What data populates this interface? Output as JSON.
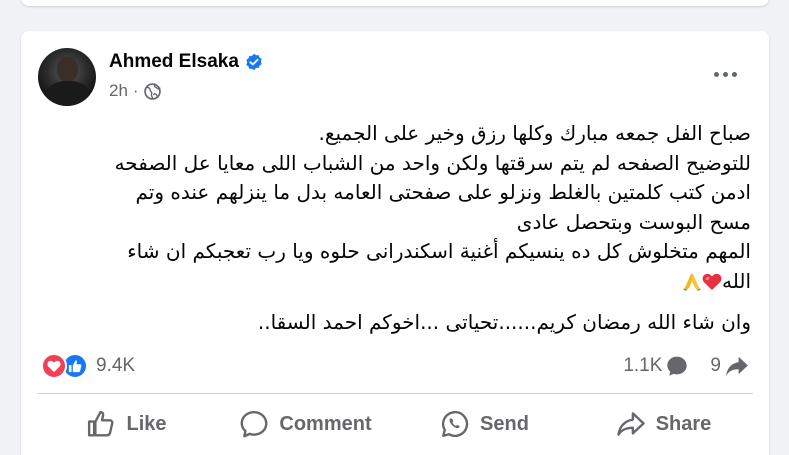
{
  "post": {
    "author": "Ahmed Elsaka",
    "time": "2h",
    "lines": [
      "صباح الفل جمعه مبارك وكلها رزق وخير على الجميع.",
      "للتوضيح الصفحه لم يتم سرقتها ولكن واحد من الشباب اللى معايا عل الصفحه",
      "ادمن كتب كلمتين بالغلط ونزلو على صفحتى العامه بدل ما ينزلهم عنده وتم",
      "مسح البوست وبتحصل عادى",
      "المهم متخلوش كل ده  ينسيكم أغنية اسكندرانى حلوه ويا رب تعجبكم ان شاء",
      "الله"
    ],
    "closing": "وان شاء الله رمضان كريم......تحياتى   ...اخوكم احمد السقا.."
  },
  "stats": {
    "reactions": "9.4K",
    "comments": "1.1K",
    "shares": "9"
  },
  "actions": {
    "like": "Like",
    "comment": "Comment",
    "send": "Send",
    "share": "Share"
  },
  "colors": {
    "like_blue": "#1877f2",
    "love_red": "#f33e58",
    "verified_blue": "#1877f2"
  }
}
